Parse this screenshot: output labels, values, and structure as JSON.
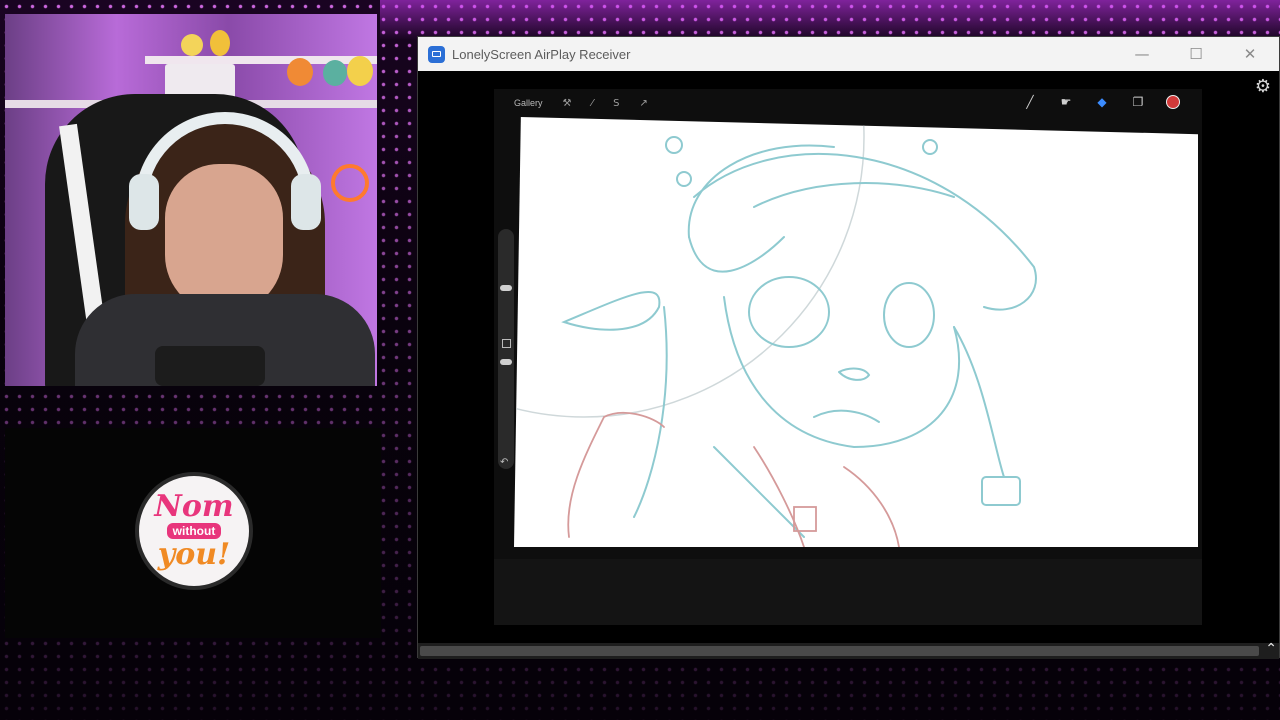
{
  "window": {
    "title": "LonelyScreen AirPlay Receiver",
    "controls": {
      "minimize": "—",
      "maximize": "☐",
      "close": "✕"
    },
    "icons": {
      "app": "airplay-monitor-icon",
      "settings": "gear-icon"
    }
  },
  "procreate": {
    "gallery_label": "Gallery",
    "left_tools": [
      "wrench-icon",
      "magic-wand-icon",
      "selection-icon",
      "transform-icon"
    ],
    "right_tools": [
      "brush-icon",
      "smudge-icon",
      "eraser-icon",
      "layers-icon"
    ],
    "color_swatch": "#d23a3a",
    "sidebar_tools": [
      "brush-size-slider",
      "modify-button",
      "opacity-slider",
      "undo-icon"
    ]
  },
  "overlay": {
    "logo": {
      "line1": "Nom",
      "line2": "without",
      "line3": "you!"
    },
    "background_accent": "#d23cff",
    "brand_pink": "#e8357c",
    "brand_orange": "#f08a24"
  }
}
